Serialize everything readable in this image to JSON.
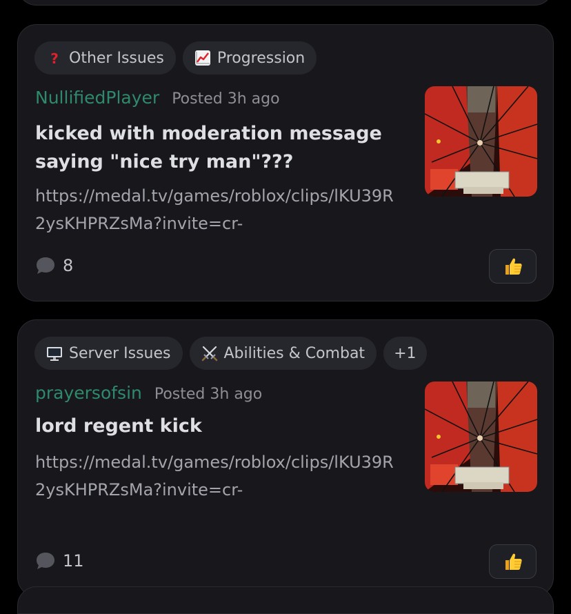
{
  "posts": [
    {
      "tags": [
        {
          "label": "Other Issues",
          "icon": "question-mark-icon"
        },
        {
          "label": "Progression",
          "icon": "chart-increasing-icon"
        }
      ],
      "author": "NullifiedPlayer",
      "posted": "Posted 3h ago",
      "title": "kicked with moderation message saying \"nice try man\"???",
      "body": "https://medal.tv/games/roblox/clips/lKU39R2ysKHPRZsMa?invite=cr-",
      "comment_count": "8",
      "thumbnail": "game-clip-thumbnail",
      "like_icon": "thumbs-up-icon"
    },
    {
      "tags": [
        {
          "label": "Server Issues",
          "icon": "desktop-computer-icon"
        },
        {
          "label": "Abilities & Combat",
          "icon": "crossed-swords-icon"
        }
      ],
      "more_tags": "+1",
      "author": "prayersofsin",
      "posted": "Posted 3h ago",
      "title": "lord regent kick",
      "body": "https://medal.tv/games/roblox/clips/lKU39R2ysKHPRZsMa?invite=cr-",
      "comment_count": "11",
      "thumbnail": "game-clip-thumbnail",
      "like_icon": "thumbs-up-icon"
    }
  ],
  "colors": {
    "background": "#000000",
    "card": "#18181c",
    "tag_bg": "#26272d",
    "author": "#2f8a6c",
    "title": "#dedfe4",
    "body": "#a4a5ac",
    "meta": "#8e8f96"
  }
}
